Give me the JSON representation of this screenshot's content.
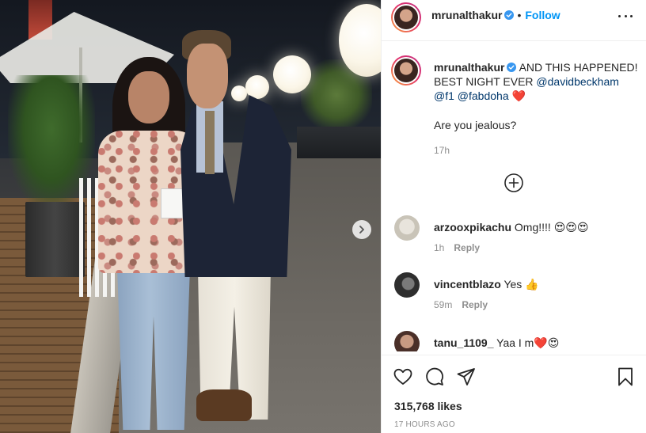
{
  "post": {
    "username": "mrunalthakur",
    "verified": true,
    "follow_label": "Follow",
    "header_separator": "•",
    "caption": {
      "text_start": "AND THIS HAPPENED! BEST NIGHT EVER ",
      "mention_1": "@davidbeckham",
      "mention_2": "@f1",
      "mention_3": "@fabdoha",
      "emoji_tail": "❤️",
      "line2": "Are you jealous?",
      "time": "17h"
    },
    "comments": [
      {
        "username": "arzooxpikachu",
        "text": "Omg!!!! 😍😍😍",
        "time": "1h",
        "reply_label": "Reply",
        "avatar_color": "#c9c4b8"
      },
      {
        "username": "vincentblazo",
        "text": "Yes 👍",
        "time": "59m",
        "reply_label": "Reply",
        "avatar_color": "#3a3a3a"
      },
      {
        "username": "tanu_1109_",
        "text": "Yaa I m❤️😍",
        "time": "",
        "reply_label": "",
        "avatar_color": "#a07a68"
      }
    ],
    "likes": "315,768 likes",
    "timestamp": "17 HOURS AGO"
  },
  "icons": [
    "more-options-icon",
    "verified-badge-icon",
    "load-more-comments-icon",
    "next-photo-icon",
    "heart-icon",
    "comment-icon",
    "share-icon",
    "bookmark-icon"
  ],
  "colors": {
    "link_blue": "#0095f6",
    "mention": "#00376b",
    "muted": "#8e8e8e",
    "text": "#262626",
    "border": "#efefef"
  }
}
